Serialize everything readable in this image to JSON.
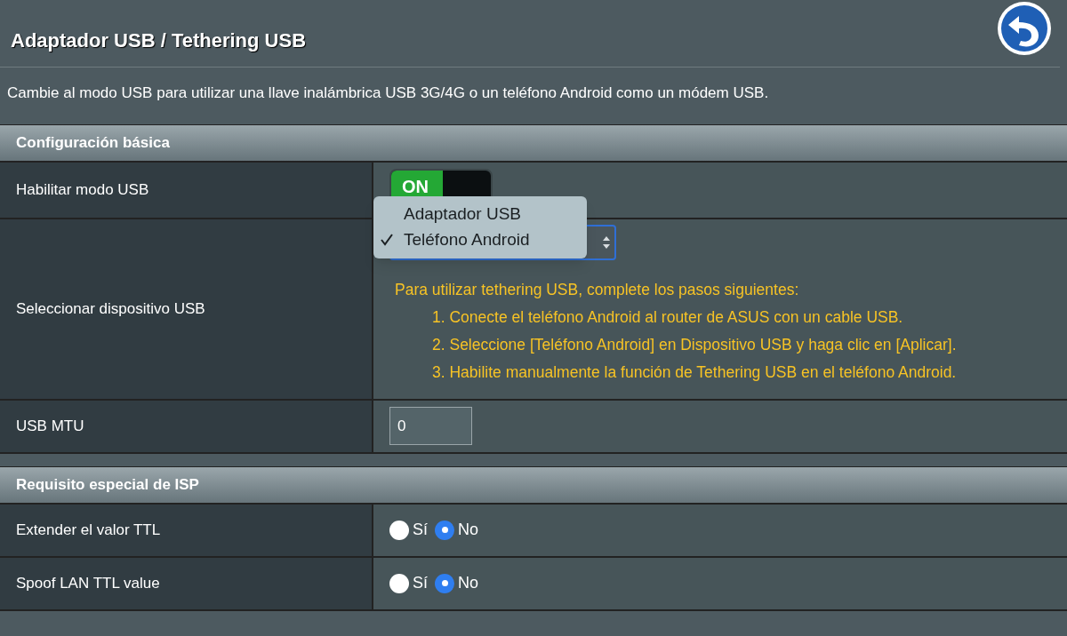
{
  "header": {
    "title": "Adaptador USB / Tethering USB"
  },
  "description": "Cambie al modo USB para utilizar una llave inalámbrica USB 3G/4G o un teléfono Android como un módem USB.",
  "sections": [
    {
      "title": "Configuración básica",
      "rows": [
        {
          "kind": "toggle",
          "label": "Habilitar modo USB",
          "on": true,
          "on_label": "ON"
        },
        {
          "kind": "select",
          "label": "Seleccionar dispositivo USB",
          "menu": [
            {
              "label": "Adaptador USB",
              "selected": false
            },
            {
              "label": "Teléfono Android",
              "selected": true
            }
          ],
          "note": {
            "intro": "Para utilizar tethering USB, complete los pasos siguientes:",
            "steps": [
              "1. Conecte el teléfono Android al router de ASUS con un cable USB.",
              "2. Seleccione [Teléfono Android] en Dispositivo USB y haga clic en [Aplicar].",
              "3. Habilite manualmente la función de Tethering USB en el teléfono Android."
            ]
          }
        },
        {
          "kind": "text",
          "label": "USB MTU",
          "value": "0"
        }
      ]
    },
    {
      "title": "Requisito especial de ISP",
      "rows": [
        {
          "kind": "radio",
          "label": "Extender el valor TTL",
          "options": [
            {
              "label": "Sí",
              "selected": false
            },
            {
              "label": "No",
              "selected": true
            }
          ]
        },
        {
          "kind": "radio",
          "label": "Spoof LAN TTL value",
          "options": [
            {
              "label": "Sí",
              "selected": false
            },
            {
              "label": "No",
              "selected": true
            }
          ]
        }
      ]
    }
  ]
}
